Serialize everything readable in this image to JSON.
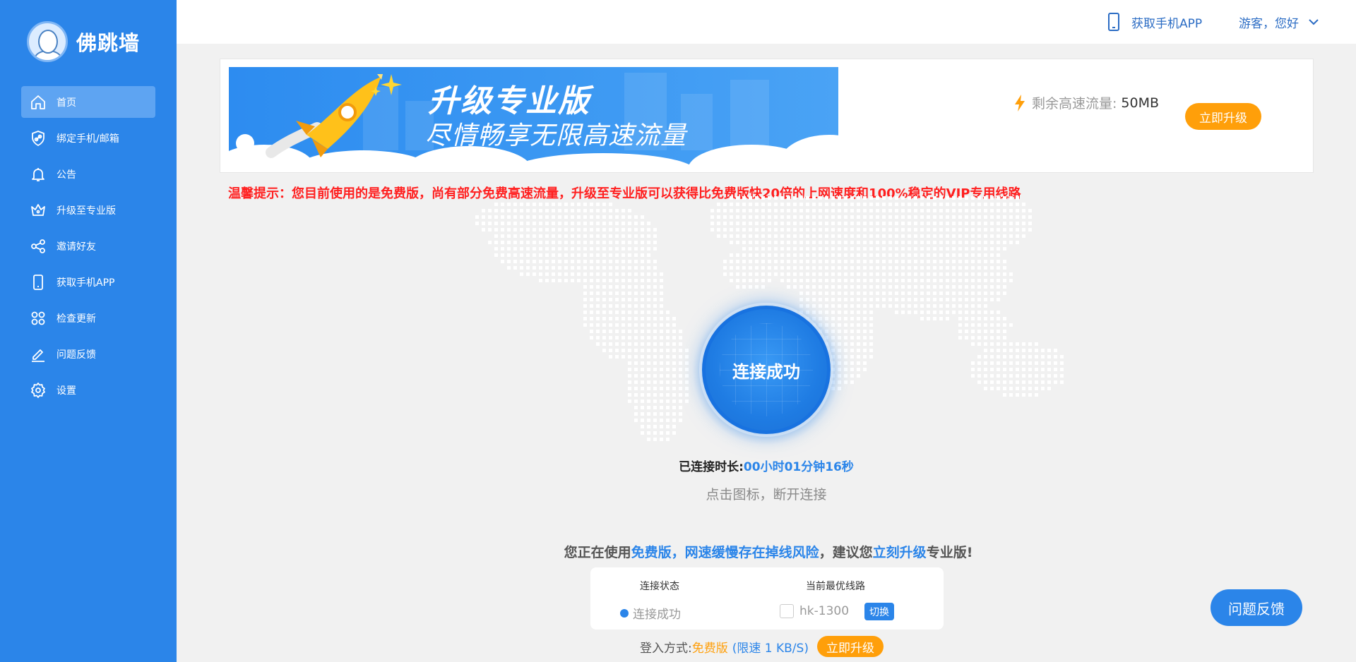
{
  "brand": {
    "name": "佛跳墙"
  },
  "sidebar": {
    "items": [
      {
        "label": "首页",
        "icon": "home-icon",
        "active": true
      },
      {
        "label": "绑定手机/邮箱",
        "icon": "shield-link-icon",
        "active": false
      },
      {
        "label": "公告",
        "icon": "bell-icon",
        "active": false
      },
      {
        "label": "升级至专业版",
        "icon": "crown-icon",
        "active": false
      },
      {
        "label": "邀请好友",
        "icon": "share-icon",
        "active": false
      },
      {
        "label": "获取手机APP",
        "icon": "phone-icon",
        "active": false
      },
      {
        "label": "检查更新",
        "icon": "grid-circles-icon",
        "active": false
      },
      {
        "label": "问题反馈",
        "icon": "edit-pen-icon",
        "active": false
      },
      {
        "label": "设置",
        "icon": "gear-icon",
        "active": false
      }
    ]
  },
  "topbar": {
    "app_label": "获取手机APP",
    "user_label": "游客，您好"
  },
  "banner": {
    "title": "升级专业版",
    "subtitle": "尽情畅享无限高速流量",
    "traffic_label": "剩余高速流量:",
    "traffic_value": "50MB",
    "upgrade_label": "立即升级"
  },
  "notice": "温馨提示：您目前使用的是免费版，尚有部分免费高速流量，升级至专业版可以获得比免费版快20倍的上网速度和100%稳定的VIP专用线路",
  "connect": {
    "status_label": "连接成功",
    "duration_label": "已连接时长:",
    "duration_value": "00小时01分钟16秒",
    "hint": "点击图标，断开连接"
  },
  "warning": {
    "p1": "您正在使用",
    "p2": "免费版，网速缓慢存在掉线风险",
    "p3": "，建议您",
    "p4": "立刻升级",
    "p5": "专业版!"
  },
  "status_box": {
    "col1_header": "连接状态",
    "col1_value": "连接成功",
    "col2_header": "当前最优线路",
    "col2_value": "hk-1300",
    "switch_label": "切换"
  },
  "login": {
    "label": "登入方式:",
    "mode": "免费版",
    "limit": "(限速 1 KB/S)",
    "upgrade_label": "立即升级"
  },
  "feedback_button": "问题反馈",
  "colors": {
    "sidebar": "#2b85e9",
    "accent_orange": "#ff9f0a",
    "notice_red": "#ff2020",
    "link_blue": "#2b85e9"
  }
}
